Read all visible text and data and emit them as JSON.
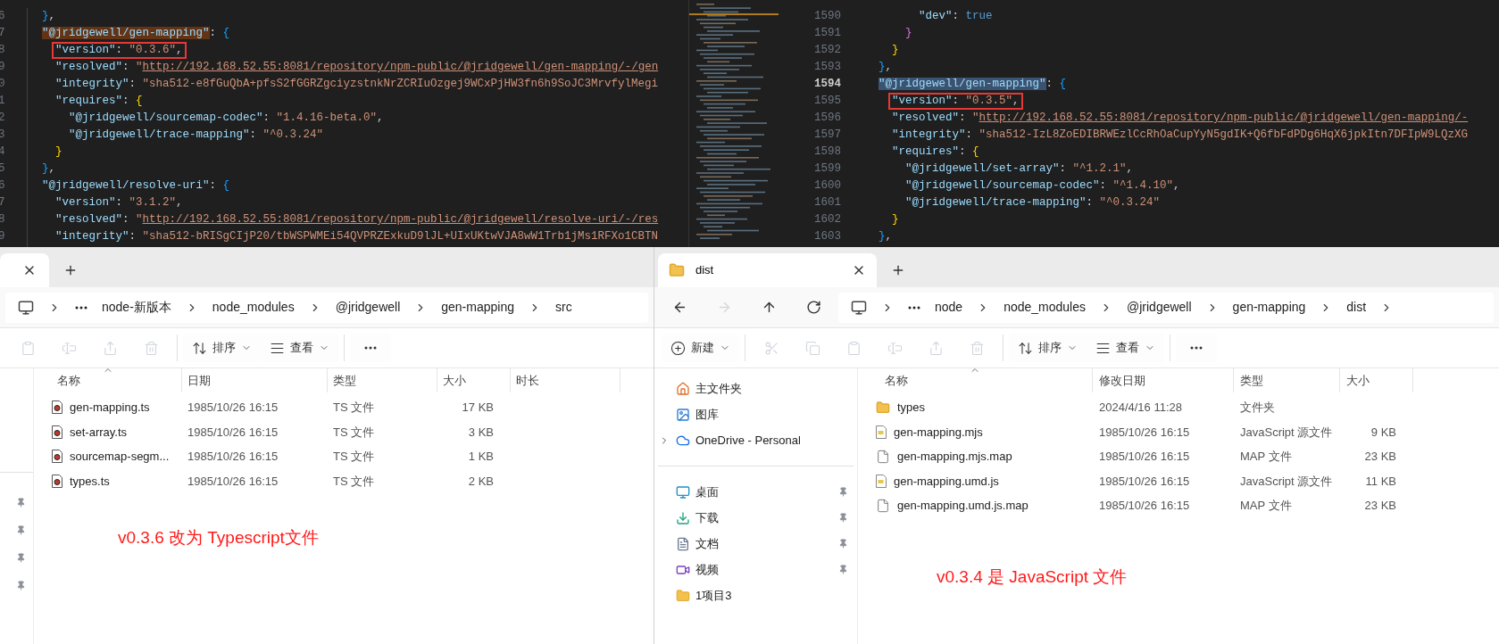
{
  "editors": [
    {
      "lines": [
        {
          "number": "6",
          "boxed": false,
          "tokens": [
            {
              "kind": "brace",
              "text": "}",
              "color": "#179fff"
            },
            {
              "kind": "punct",
              "text": ","
            }
          ]
        },
        {
          "number": "7",
          "boxed": false,
          "tokens": [
            {
              "kind": "key",
              "text": "\"@jridgewell/gen-mapping\"",
              "highlighted": true
            },
            {
              "kind": "punct",
              "text": ": "
            },
            {
              "kind": "brace",
              "text": "{",
              "color": "#179fff"
            }
          ]
        },
        {
          "number": "8",
          "boxed": true,
          "tokens": [
            {
              "kind": "key",
              "text": "\"version\"",
              "highlighted": false
            },
            {
              "kind": "punct",
              "text": ": "
            },
            {
              "kind": "string",
              "text": "\"0.3.6\""
            },
            {
              "kind": "punct",
              "text": ","
            }
          ]
        },
        {
          "number": "9",
          "boxed": false,
          "tokens": [
            {
              "kind": "key",
              "text": "\"resolved\"",
              "highlighted": false
            },
            {
              "kind": "punct",
              "text": ": "
            },
            {
              "kind": "string",
              "text": "\""
            },
            {
              "kind": "link",
              "text": "http://192.168.52.55:8081/repository/npm-public/@jridgewell/gen-mapping/-/gen"
            }
          ]
        },
        {
          "number": "0",
          "boxed": false,
          "tokens": [
            {
              "kind": "key",
              "text": "\"integrity\"",
              "highlighted": false
            },
            {
              "kind": "punct",
              "text": ": "
            },
            {
              "kind": "string",
              "text": "\"sha512-e8fGuQbA+pfsS2fGGRZgciyzstnkNrZCRIuOzgej9WCxPjHW3fn6h9SoJC3MrvfylMegi"
            }
          ]
        },
        {
          "number": "1",
          "boxed": false,
          "tokens": [
            {
              "kind": "key",
              "text": "\"requires\"",
              "highlighted": false
            },
            {
              "kind": "punct",
              "text": ": "
            },
            {
              "kind": "brace",
              "text": "{",
              "color": "#ffd700"
            }
          ]
        },
        {
          "number": "2",
          "boxed": false,
          "tokens": [
            {
              "kind": "key",
              "text": "\"@jridgewell/sourcemap-codec\"",
              "highlighted": false
            },
            {
              "kind": "punct",
              "text": ": "
            },
            {
              "kind": "string",
              "text": "\"1.4.16-beta.0\""
            },
            {
              "kind": "punct",
              "text": ","
            }
          ]
        },
        {
          "number": "3",
          "boxed": false,
          "tokens": [
            {
              "kind": "key",
              "text": "\"@jridgewell/trace-mapping\"",
              "highlighted": false
            },
            {
              "kind": "punct",
              "text": ": "
            },
            {
              "kind": "string",
              "text": "\"^0.3.24\""
            }
          ]
        },
        {
          "number": "4",
          "boxed": false,
          "tokens": [
            {
              "kind": "brace",
              "text": "}",
              "color": "#ffd700"
            }
          ]
        },
        {
          "number": "5",
          "boxed": false,
          "tokens": [
            {
              "kind": "brace",
              "text": "}",
              "color": "#179fff"
            },
            {
              "kind": "punct",
              "text": ","
            }
          ]
        },
        {
          "number": "6",
          "boxed": false,
          "tokens": [
            {
              "kind": "key",
              "text": "\"@jridgewell/resolve-uri\"",
              "highlighted": false
            },
            {
              "kind": "punct",
              "text": ": "
            },
            {
              "kind": "brace",
              "text": "{",
              "color": "#179fff"
            }
          ]
        },
        {
          "number": "7",
          "boxed": false,
          "tokens": [
            {
              "kind": "key",
              "text": "\"version\"",
              "highlighted": false
            },
            {
              "kind": "punct",
              "text": ": "
            },
            {
              "kind": "string",
              "text": "\"3.1.2\""
            },
            {
              "kind": "punct",
              "text": ","
            }
          ]
        },
        {
          "number": "8",
          "boxed": false,
          "tokens": [
            {
              "kind": "key",
              "text": "\"resolved\"",
              "highlighted": false
            },
            {
              "kind": "punct",
              "text": ": "
            },
            {
              "kind": "string",
              "text": "\""
            },
            {
              "kind": "link",
              "text": "http://192.168.52.55:8081/repository/npm-public/@jridgewell/resolve-uri/-/res"
            }
          ]
        },
        {
          "number": "9",
          "boxed": false,
          "tokens": [
            {
              "kind": "key",
              "text": "\"integrity\"",
              "highlighted": false
            },
            {
              "kind": "punct",
              "text": ": "
            },
            {
              "kind": "string",
              "text": "\"sha512-bRISgCIjP20/tbWSPWMEi54QVPRZExkuD9lJL+UIxUKtwVJA8wW1Trb1jMs1RFXo1CBTN"
            }
          ]
        }
      ]
    },
    {
      "lines": [
        {
          "number": "1590",
          "boxed": false,
          "current": false,
          "tokens": [
            {
              "kind": "key",
              "text": "\"dev\"",
              "highlighted": false
            },
            {
              "kind": "punct",
              "text": ": "
            },
            {
              "kind": "bool",
              "text": "true"
            }
          ]
        },
        {
          "number": "1591",
          "boxed": false,
          "current": false,
          "tokens": [
            {
              "kind": "brace",
              "text": "}",
              "color": "#da70d6"
            }
          ]
        },
        {
          "number": "1592",
          "boxed": false,
          "current": false,
          "tokens": [
            {
              "kind": "brace",
              "text": "}",
              "color": "#ffd700"
            }
          ]
        },
        {
          "number": "1593",
          "boxed": false,
          "current": false,
          "tokens": [
            {
              "kind": "brace",
              "text": "}",
              "color": "#179fff"
            },
            {
              "kind": "punct",
              "text": ","
            }
          ]
        },
        {
          "number": "1594",
          "boxed": false,
          "current": true,
          "tokens": [
            {
              "kind": "key",
              "text": "\"@jridgewell/gen-mapping\"",
              "highlighted": true
            },
            {
              "kind": "punct",
              "text": ": "
            },
            {
              "kind": "brace",
              "text": "{",
              "color": "#179fff"
            }
          ]
        },
        {
          "number": "1595",
          "boxed": true,
          "current": false,
          "tokens": [
            {
              "kind": "key",
              "text": "\"version\"",
              "highlighted": false
            },
            {
              "kind": "punct",
              "text": ": "
            },
            {
              "kind": "string",
              "text": "\"0.3.5\""
            },
            {
              "kind": "punct",
              "text": ","
            }
          ]
        },
        {
          "number": "1596",
          "boxed": false,
          "current": false,
          "tokens": [
            {
              "kind": "key",
              "text": "\"resolved\"",
              "highlighted": false
            },
            {
              "kind": "punct",
              "text": ": "
            },
            {
              "kind": "string",
              "text": "\""
            },
            {
              "kind": "link",
              "text": "http://192.168.52.55:8081/repository/npm-public/@jridgewell/gen-mapping/-"
            }
          ]
        },
        {
          "number": "1597",
          "boxed": false,
          "current": false,
          "tokens": [
            {
              "kind": "key",
              "text": "\"integrity\"",
              "highlighted": false
            },
            {
              "kind": "punct",
              "text": ": "
            },
            {
              "kind": "string",
              "text": "\"sha512-IzL8ZoEDIBRWEzlCcRhOaCupYyN5gdIK+Q6fbFdPDg6HqX6jpkItn7DFIpW9LQzXG"
            }
          ]
        },
        {
          "number": "1598",
          "boxed": false,
          "current": false,
          "tokens": [
            {
              "kind": "key",
              "text": "\"requires\"",
              "highlighted": false
            },
            {
              "kind": "punct",
              "text": ": "
            },
            {
              "kind": "brace",
              "text": "{",
              "color": "#ffd700"
            }
          ]
        },
        {
          "number": "1599",
          "boxed": false,
          "current": false,
          "tokens": [
            {
              "kind": "key",
              "text": "\"@jridgewell/set-array\"",
              "highlighted": false
            },
            {
              "kind": "punct",
              "text": ": "
            },
            {
              "kind": "string",
              "text": "\"^1.2.1\""
            },
            {
              "kind": "punct",
              "text": ","
            }
          ]
        },
        {
          "number": "1600",
          "boxed": false,
          "current": false,
          "tokens": [
            {
              "kind": "key",
              "text": "\"@jridgewell/sourcemap-codec\"",
              "highlighted": false
            },
            {
              "kind": "punct",
              "text": ": "
            },
            {
              "kind": "string",
              "text": "\"^1.4.10\""
            },
            {
              "kind": "punct",
              "text": ","
            }
          ]
        },
        {
          "number": "1601",
          "boxed": false,
          "current": false,
          "tokens": [
            {
              "kind": "key",
              "text": "\"@jridgewell/trace-mapping\"",
              "highlighted": false
            },
            {
              "kind": "punct",
              "text": ": "
            },
            {
              "kind": "string",
              "text": "\"^0.3.24\""
            }
          ]
        },
        {
          "number": "1602",
          "boxed": false,
          "current": false,
          "tokens": [
            {
              "kind": "brace",
              "text": "}",
              "color": "#ffd700"
            }
          ]
        },
        {
          "number": "1603",
          "boxed": false,
          "current": false,
          "tokens": [
            {
              "kind": "brace",
              "text": "}",
              "color": "#179fff"
            },
            {
              "kind": "punct",
              "text": ","
            }
          ]
        }
      ]
    }
  ],
  "explorers": [
    {
      "breadcrumb": {
        "items": [
          "node-新版本",
          "node_modules",
          "@jridgewell",
          "gen-mapping",
          "src"
        ],
        "trailing_chevron": false
      },
      "toolbar": [
        {
          "kind": "paste",
          "disabled": true
        },
        {
          "kind": "rename",
          "disabled": true
        },
        {
          "kind": "share",
          "disabled": true
        },
        {
          "kind": "delete",
          "disabled": true
        },
        {
          "kind": "sort",
          "label": "排序",
          "disabled": false
        },
        {
          "kind": "view",
          "label": "查看",
          "disabled": false
        },
        {
          "kind": "more",
          "disabled": false
        }
      ],
      "sidebar": [
        {
          "pinned": true
        },
        {
          "pinned": true
        },
        {
          "pinned": true
        },
        {
          "pinned": true
        }
      ],
      "columns": [
        {
          "label": "名称",
          "sorted": true
        },
        {
          "label": "日期",
          "sorted": false
        },
        {
          "label": "类型",
          "sorted": false
        },
        {
          "label": "大小",
          "sorted": false
        },
        {
          "label": "时长",
          "sorted": false
        }
      ],
      "rows": [
        {
          "kind": "ts",
          "name": "gen-mapping.ts",
          "date": "1985/10/26 16:15",
          "type": "TS 文件",
          "size": "17 KB"
        },
        {
          "kind": "ts",
          "name": "set-array.ts",
          "date": "1985/10/26 16:15",
          "type": "TS 文件",
          "size": "3 KB"
        },
        {
          "kind": "ts",
          "name": "sourcemap-segm...",
          "date": "1985/10/26 16:15",
          "type": "TS 文件",
          "size": "1 KB"
        },
        {
          "kind": "ts",
          "name": "types.ts",
          "date": "1985/10/26 16:15",
          "type": "TS 文件",
          "size": "2 KB"
        }
      ],
      "note": "v0.3.6 改为 Typescript文件"
    },
    {
      "tab": {
        "title": "dist"
      },
      "nav": [
        {
          "kind": "back",
          "disabled": false
        },
        {
          "kind": "forward",
          "disabled": true
        },
        {
          "kind": "up",
          "disabled": false
        },
        {
          "kind": "refresh",
          "disabled": false
        }
      ],
      "breadcrumb": {
        "items": [
          "node",
          "node_modules",
          "@jridgewell",
          "gen-mapping",
          "dist"
        ],
        "trailing_chevron": true
      },
      "toolbar": [
        {
          "kind": "new",
          "label": "新建",
          "disabled": false
        },
        {
          "kind": "cut",
          "disabled": true
        },
        {
          "kind": "copy",
          "disabled": true
        },
        {
          "kind": "paste",
          "disabled": true
        },
        {
          "kind": "rename",
          "disabled": true
        },
        {
          "kind": "share",
          "disabled": true
        },
        {
          "kind": "delete",
          "disabled": true
        },
        {
          "kind": "sort",
          "label": "排序",
          "disabled": false
        },
        {
          "kind": "view",
          "label": "查看",
          "disabled": false
        },
        {
          "kind": "more",
          "disabled": false
        }
      ],
      "sidebar": [
        {
          "kind": "home",
          "label": "主文件夹",
          "pinned": false
        },
        {
          "kind": "gallery",
          "label": "图库",
          "pinned": false
        },
        {
          "kind": "cloud",
          "label": "OneDrive - Personal",
          "pinned": false,
          "expanded": false
        },
        {
          "kind": "divider"
        },
        {
          "kind": "desktop",
          "label": "桌面",
          "pinned": true
        },
        {
          "kind": "download",
          "label": "下载",
          "pinned": true
        },
        {
          "kind": "document",
          "label": "文档",
          "pinned": true
        },
        {
          "kind": "video",
          "label": "视频",
          "pinned": true
        },
        {
          "kind": "folder",
          "label": "1项目3",
          "pinned": false
        }
      ],
      "columns": [
        {
          "label": "名称",
          "sorted": true
        },
        {
          "label": "修改日期",
          "sorted": false
        },
        {
          "label": "类型",
          "sorted": false
        },
        {
          "label": "大小",
          "sorted": false
        }
      ],
      "rows": [
        {
          "kind": "folder",
          "name": "types",
          "date": "2024/4/16 11:28",
          "type": "文件夹"
        },
        {
          "kind": "js",
          "name": "gen-mapping.mjs",
          "date": "1985/10/26 16:15",
          "type": "JavaScript 源文件",
          "size": "9 KB"
        },
        {
          "kind": "map",
          "name": "gen-mapping.mjs.map",
          "date": "1985/10/26 16:15",
          "type": "MAP 文件",
          "size": "23 KB"
        },
        {
          "kind": "js",
          "name": "gen-mapping.umd.js",
          "date": "1985/10/26 16:15",
          "type": "JavaScript 源文件",
          "size": "11 KB"
        },
        {
          "kind": "map",
          "name": "gen-mapping.umd.js.map",
          "date": "1985/10/26 16:15",
          "type": "MAP 文件",
          "size": "23 KB"
        }
      ],
      "note": "v0.3.4 是 JavaScript 文件"
    }
  ]
}
